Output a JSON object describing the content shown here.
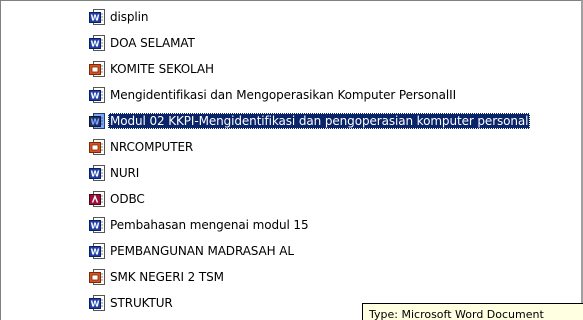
{
  "files": [
    {
      "name": "displin",
      "icon": "word-document-icon",
      "type": "word",
      "selected": false
    },
    {
      "name": "DOA SELAMAT",
      "icon": "word-document-icon",
      "type": "word",
      "selected": false
    },
    {
      "name": "KOMITE SEKOLAH",
      "icon": "powerpoint-presentation-icon",
      "type": "ppt",
      "selected": false
    },
    {
      "name": "Mengidentifikasi dan Mengoperasikan Komputer PersonalII",
      "icon": "word-document-icon",
      "type": "word",
      "selected": false
    },
    {
      "name": "Modul 02 KKPI-Mengidentifikasi dan pengoperasian komputer personal",
      "icon": "word-document-icon",
      "type": "word",
      "selected": true
    },
    {
      "name": "NRCOMPUTER",
      "icon": "powerpoint-presentation-icon",
      "type": "ppt",
      "selected": false
    },
    {
      "name": "NURI",
      "icon": "word-document-icon",
      "type": "word",
      "selected": false
    },
    {
      "name": "ODBC",
      "icon": "access-database-icon",
      "type": "access",
      "selected": false
    },
    {
      "name": "Pembahasan mengenai modul 15",
      "icon": "word-document-icon",
      "type": "word",
      "selected": false
    },
    {
      "name": "PEMBANGUNAN MADRASAH AL",
      "icon": "word-document-icon",
      "type": "word",
      "selected": false
    },
    {
      "name": "SMK NEGERI 2 TSM",
      "icon": "powerpoint-presentation-icon",
      "type": "ppt",
      "selected": false
    },
    {
      "name": "STRUKTUR",
      "icon": "word-document-icon",
      "type": "word",
      "selected": false
    }
  ],
  "tooltip": {
    "text": "Type: Microsoft Word Document"
  },
  "colors": {
    "selection": "#0a246a",
    "word": "#1f3fa8",
    "ppt": "#d9531e",
    "access": "#a0113a",
    "tooltip_bg": "#ffffe1"
  }
}
